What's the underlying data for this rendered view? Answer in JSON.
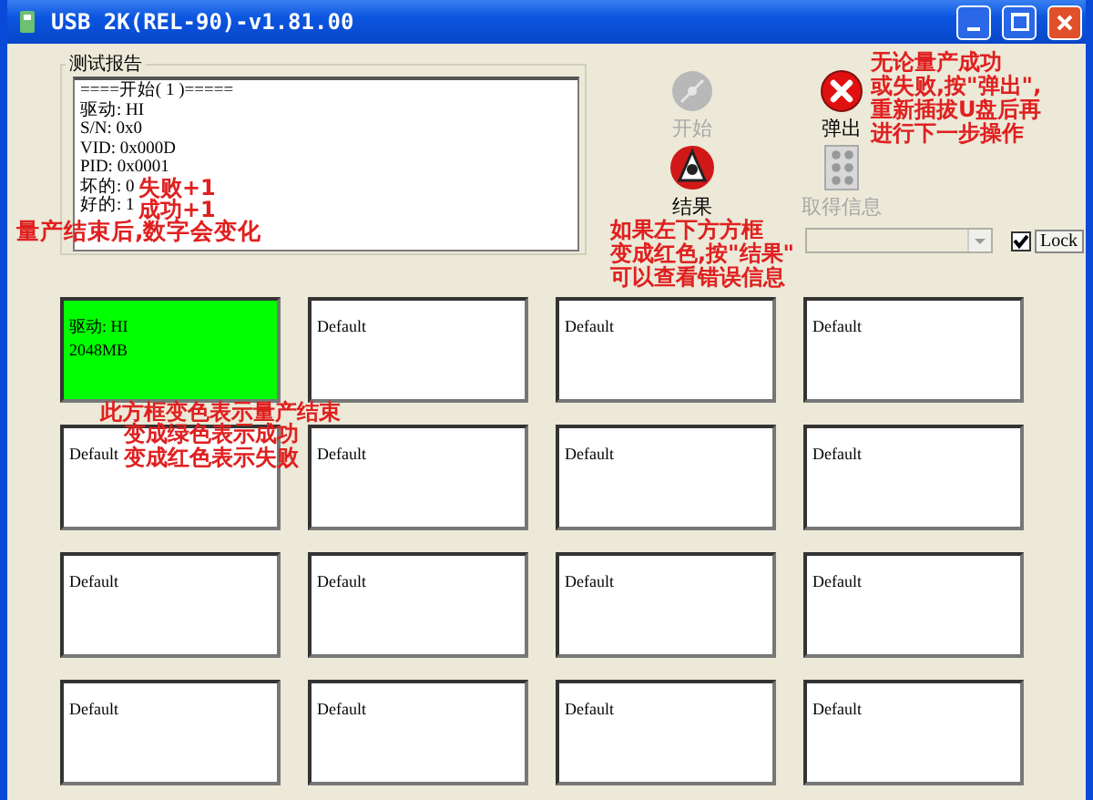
{
  "window": {
    "title": "USB 2K(REL-90)-v1.81.00"
  },
  "report": {
    "title": "测试报告",
    "lines": [
      "====开始( 1 )=====",
      "驱动: HI",
      "S/N: 0x0",
      "VID: 0x000D",
      "PID: 0x0001",
      "坏的: 0",
      "好的: 1"
    ]
  },
  "buttons": [
    {
      "kind": "start",
      "label": "开始",
      "disabled": true
    },
    {
      "kind": "eject",
      "label": "弹出",
      "disabled": false
    },
    {
      "kind": "result",
      "label": "结果",
      "disabled": false
    },
    {
      "kind": "info",
      "label": "取得信息",
      "disabled": true
    }
  ],
  "lock": {
    "label": "Lock",
    "checked": true
  },
  "slots": [
    {
      "lines": [
        "驱动: HI",
        "2048MB"
      ],
      "color": "#00ff00"
    },
    {
      "lines": [
        "Default"
      ],
      "color": "#ffffff"
    },
    {
      "lines": [
        "Default"
      ],
      "color": "#ffffff"
    },
    {
      "lines": [
        "Default"
      ],
      "color": "#ffffff"
    },
    {
      "lines": [
        "Default"
      ],
      "color": "#ffffff"
    },
    {
      "lines": [
        "Default"
      ],
      "color": "#ffffff"
    },
    {
      "lines": [
        "Default"
      ],
      "color": "#ffffff"
    },
    {
      "lines": [
        "Default"
      ],
      "color": "#ffffff"
    },
    {
      "lines": [
        "Default"
      ],
      "color": "#ffffff"
    },
    {
      "lines": [
        "Default"
      ],
      "color": "#ffffff"
    },
    {
      "lines": [
        "Default"
      ],
      "color": "#ffffff"
    },
    {
      "lines": [
        "Default"
      ],
      "color": "#ffffff"
    },
    {
      "lines": [
        "Default"
      ],
      "color": "#ffffff"
    },
    {
      "lines": [
        "Default"
      ],
      "color": "#ffffff"
    },
    {
      "lines": [
        "Default"
      ],
      "color": "#ffffff"
    },
    {
      "lines": [
        "Default"
      ],
      "color": "#ffffff"
    }
  ],
  "annotations": [
    {
      "text": "失败+1"
    },
    {
      "text": "成功+1"
    },
    {
      "text": "量产结束后,数字会变化"
    },
    {
      "text": "无论量产成功"
    },
    {
      "text": "或失败,按\"弹出\","
    },
    {
      "text": "重新插拔U盘后再"
    },
    {
      "text": "进行下一步操作"
    },
    {
      "text": "如果左下方方框"
    },
    {
      "text": "变成红色,按\"结果\""
    },
    {
      "text": "可以查看错误信息"
    },
    {
      "text": "此方框变色表示量产结束"
    },
    {
      "text": "变成绿色表示成功"
    },
    {
      "text": "变成红色表示失败"
    }
  ]
}
